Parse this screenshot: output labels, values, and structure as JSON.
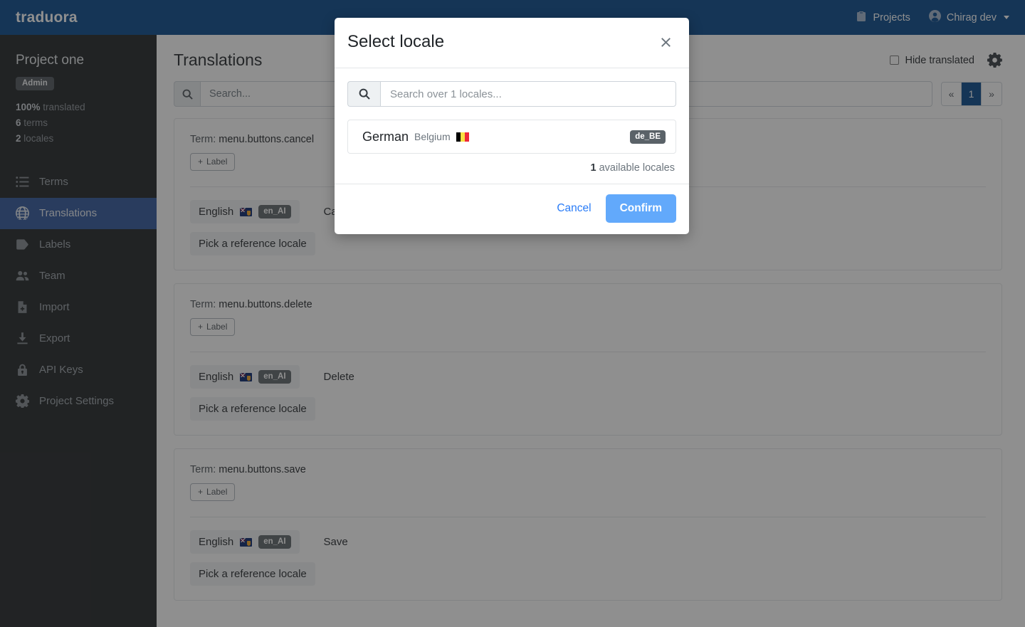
{
  "topbar": {
    "brand": "traduora",
    "projects_label": "Projects",
    "user_label": "Chirag dev",
    "brand_bg": "#004489"
  },
  "sidebar": {
    "project_name": "Project one",
    "role_badge": "Admin",
    "stats": [
      {
        "value": "100%",
        "label": "translated"
      },
      {
        "value": "6",
        "label": "terms"
      },
      {
        "value": "2",
        "label": "locales"
      }
    ],
    "items": [
      {
        "label": "Terms",
        "icon": "list-icon",
        "active": false
      },
      {
        "label": "Translations",
        "icon": "globe-icon",
        "active": true
      },
      {
        "label": "Labels",
        "icon": "tag-icon",
        "active": false
      },
      {
        "label": "Team",
        "icon": "people-icon",
        "active": false
      },
      {
        "label": "Import",
        "icon": "file-import-icon",
        "active": false
      },
      {
        "label": "Export",
        "icon": "download-icon",
        "active": false
      },
      {
        "label": "API Keys",
        "icon": "lock-icon",
        "active": false
      },
      {
        "label": "Project Settings",
        "icon": "gear-icon",
        "active": false
      }
    ],
    "active_bg": "#2a5298"
  },
  "main": {
    "page_title": "Translations",
    "hide_translated_label": "Hide translated",
    "search_placeholder": "Search...",
    "pagination": {
      "prev": "«",
      "current": "1",
      "next": "»"
    },
    "label_button": "Label",
    "reference_locale_button": "Pick a reference locale",
    "term_prefix": "Term:",
    "cards": [
      {
        "term": "menu.buttons.cancel",
        "locale_name": "English",
        "locale_code": "en_AI",
        "value": "Cancel"
      },
      {
        "term": "menu.buttons.delete",
        "locale_name": "English",
        "locale_code": "en_AI",
        "value": "Delete"
      },
      {
        "term": "menu.buttons.save",
        "locale_name": "English",
        "locale_code": "en_AI",
        "value": "Save"
      }
    ]
  },
  "modal": {
    "title": "Select locale",
    "search_placeholder": "Search over 1 locales...",
    "locale": {
      "name": "German",
      "country": "Belgium",
      "code": "de_BE",
      "flag": "belgium-flag"
    },
    "available_count": "1",
    "available_text": "available locales",
    "cancel_label": "Cancel",
    "confirm_label": "Confirm",
    "confirm_bg": "#62a9fb",
    "cancel_color": "#2a7cf7"
  }
}
